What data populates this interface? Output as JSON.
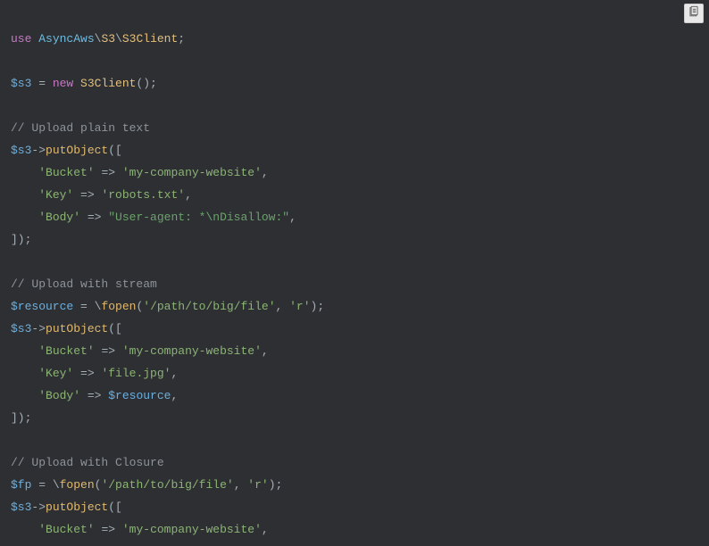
{
  "copy_btn_title": "Copy",
  "code": {
    "l1": {
      "use": "use",
      "sp": " ",
      "ns1": "AsyncAws",
      "bs1": "\\",
      "ns2": "S3",
      "bs2": "\\",
      "ns3": "S3Client",
      "semi": ";"
    },
    "l2": "",
    "l3": {
      "var": "$s3",
      "eq": " = ",
      "new": "new",
      "sp": " ",
      "cls": "S3Client",
      "paren": "();"
    },
    "l4": "",
    "l5": {
      "c": "// Upload plain text"
    },
    "l6": {
      "var": "$s3",
      "arrow": "->",
      "m": "putObject",
      "open": "(["
    },
    "l7": {
      "indent": "    ",
      "k": "'Bucket'",
      "arr": " => ",
      "v": "'my-company-website'",
      "comma": ","
    },
    "l8": {
      "indent": "    ",
      "k": "'Key'",
      "arr": " => ",
      "v": "'robots.txt'",
      "comma": ","
    },
    "l9": {
      "indent": "    ",
      "k": "'Body'",
      "arr": " => ",
      "v": "\"User-agent: *\\nDisallow:\"",
      "comma": ","
    },
    "l10": {
      "close": "]);"
    },
    "l11": "",
    "l12": {
      "c": "// Upload with stream"
    },
    "l13": {
      "var": "$resource",
      "eq": " = ",
      "bs": "\\",
      "fn": "fopen",
      "open": "(",
      "a1": "'/path/to/big/file'",
      "comma": ", ",
      "a2": "'r'",
      "close": ");"
    },
    "l14": {
      "var": "$s3",
      "arrow": "->",
      "m": "putObject",
      "open": "(["
    },
    "l15": {
      "indent": "    ",
      "k": "'Bucket'",
      "arr": " => ",
      "v": "'my-company-website'",
      "comma": ","
    },
    "l16": {
      "indent": "    ",
      "k": "'Key'",
      "arr": " => ",
      "v": "'file.jpg'",
      "comma": ","
    },
    "l17": {
      "indent": "    ",
      "k": "'Body'",
      "arr": " => ",
      "v": "$resource",
      "comma": ","
    },
    "l18": {
      "close": "]);"
    },
    "l19": "",
    "l20": {
      "c": "// Upload with Closure"
    },
    "l21": {
      "var": "$fp",
      "eq": " = ",
      "bs": "\\",
      "fn": "fopen",
      "open": "(",
      "a1": "'/path/to/big/file'",
      "comma": ", ",
      "a2": "'r'",
      "close": ");"
    },
    "l22": {
      "var": "$s3",
      "arrow": "->",
      "m": "putObject",
      "open": "(["
    },
    "l23": {
      "indent": "    ",
      "k": "'Bucket'",
      "arr": " => ",
      "v": "'my-company-website'",
      "comma": ","
    }
  }
}
